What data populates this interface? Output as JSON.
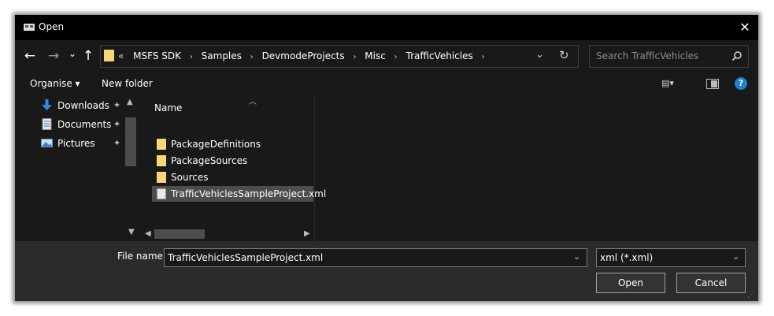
{
  "window": {
    "title": "Open",
    "close_glyph": "✕"
  },
  "nav": {
    "back_glyph": "←",
    "forward_glyph": "→",
    "recent_glyph": "⌄",
    "up_glyph": "↑",
    "address": {
      "overflow": "«",
      "crumbs": [
        "MSFS SDK",
        "Samples",
        "DevmodeProjects",
        "Misc",
        "TrafficVehicles"
      ],
      "separator": "›",
      "dropdown_glyph": "⌄",
      "refresh_glyph": "↻"
    },
    "search": {
      "placeholder": "Search TrafficVehicles",
      "icon": "search-icon"
    }
  },
  "toolbar": {
    "organise_label": "Organise ▾",
    "new_folder_label": "New folder",
    "view_glyph": "▤▾",
    "help_label": "?"
  },
  "nav_pane": {
    "items": [
      {
        "label": "Downloads",
        "icon": "download-arrow-icon"
      },
      {
        "label": "Documents",
        "icon": "document-icon"
      },
      {
        "label": "Pictures",
        "icon": "pictures-icon"
      }
    ],
    "pin_glyph": "✦"
  },
  "file_list": {
    "column_name": "Name",
    "rows": [
      {
        "label": "PackageDefinitions",
        "type": "folder"
      },
      {
        "label": "PackageSources",
        "type": "folder"
      },
      {
        "label": "Sources",
        "type": "folder"
      },
      {
        "label": "TrafficVehiclesSampleProject.xml",
        "type": "xml",
        "selected": true
      }
    ]
  },
  "bottom": {
    "file_name_label": "File name:",
    "file_name_value": "TrafficVehiclesSampleProject.xml",
    "file_type_value": "xml (*.xml)",
    "open_label": "Open",
    "cancel_label": "Cancel"
  },
  "colors": {
    "folder": "#f8d775",
    "accent": "#1e7fd6",
    "background": "#191919",
    "selection": "#4d4d4d"
  }
}
